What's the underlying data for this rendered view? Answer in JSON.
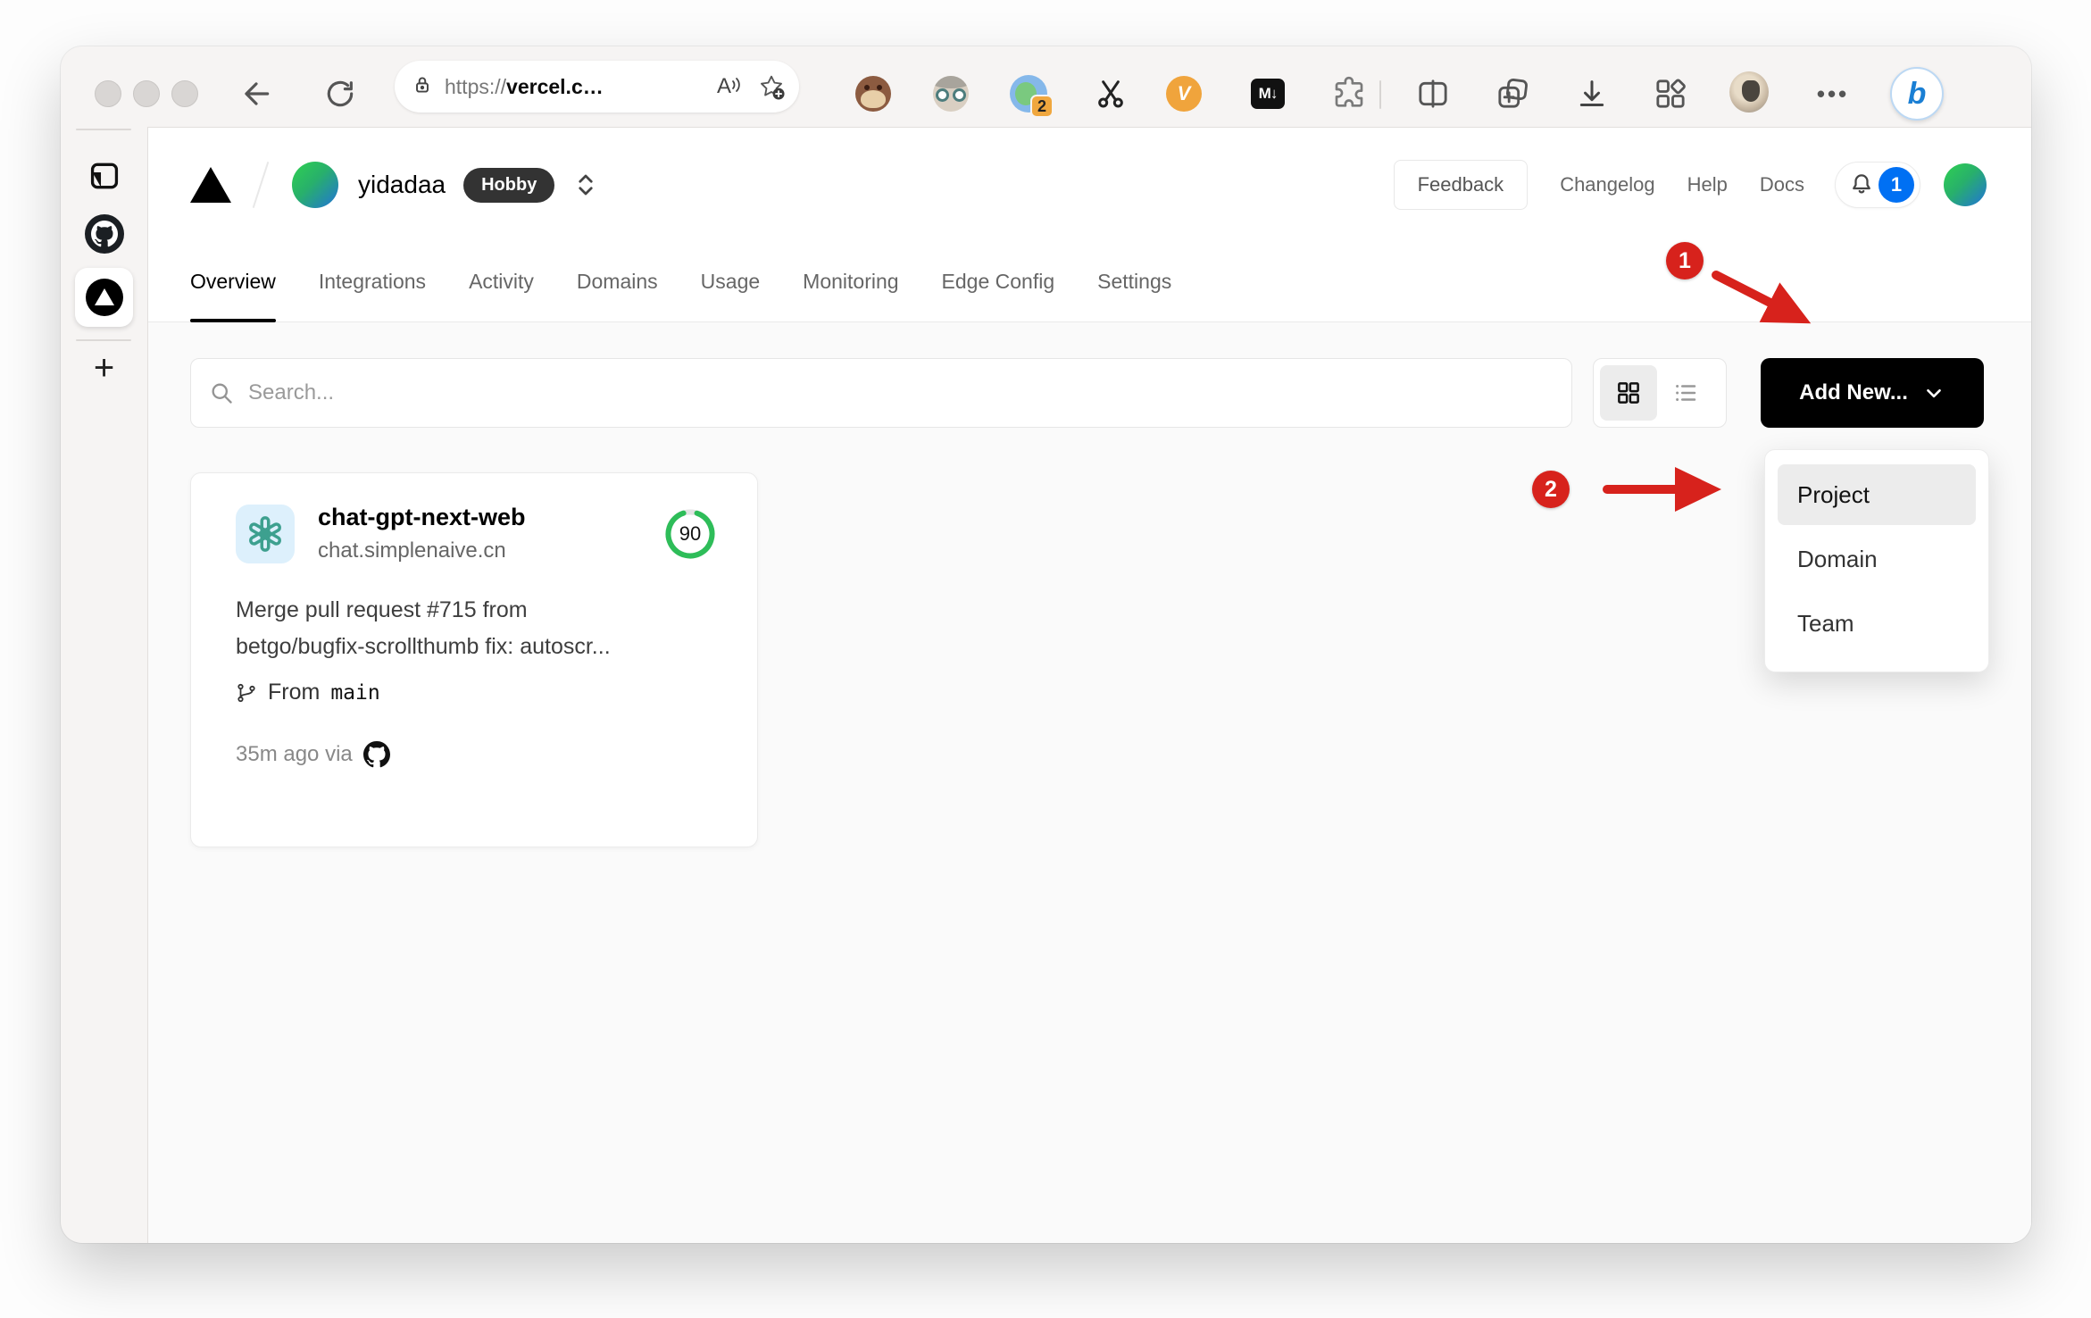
{
  "colors": {
    "accent_red": "#d7221c",
    "ring_green": "#2ebd59",
    "badge_blue": "#0070f3",
    "openai_teal": "#3da08f",
    "openai_tile_bg": "#ddf0fc",
    "av_from": "#2fd150",
    "av_mid": "#28b06b",
    "av_to": "#2173d8"
  },
  "browser": {
    "url": {
      "scheme": "https://",
      "domain": "vercel.c…"
    },
    "read_aloud_label": "A",
    "ext_tab_badge": "2",
    "ext_v_label": "V",
    "ext_md_label": "M↓",
    "more_dots": "•••",
    "copilot_label": "b",
    "toolbar_icon_names": [
      "back-icon",
      "reload-icon",
      "lock-icon",
      "read-aloud-icon",
      "favorite-add-icon",
      "tampermonkey-icon",
      "avatar-ext-icon",
      "tab-manager-ext-icon",
      "scissors-icon",
      "v-ext-icon",
      "markdown-download-icon",
      "extensions-puzzle-icon",
      "split-screen-icon",
      "collections-icon",
      "download-icon",
      "apps-grid-icon",
      "profile-avatar",
      "more-icon",
      "copilot-bing-icon"
    ],
    "sidebar_icon_names": [
      "tab-panel-icon",
      "github-favicon",
      "vercel-favicon-active-tab",
      "new-tab-plus"
    ]
  },
  "header": {
    "team_name": "yidadaa",
    "plan_badge": "Hobby",
    "feedback": "Feedback",
    "changelog": "Changelog",
    "help": "Help",
    "docs": "Docs",
    "notification_count": "1"
  },
  "tabs": [
    {
      "label": "Overview",
      "active": true
    },
    {
      "label": "Integrations",
      "active": false
    },
    {
      "label": "Activity",
      "active": false
    },
    {
      "label": "Domains",
      "active": false
    },
    {
      "label": "Usage",
      "active": false
    },
    {
      "label": "Monitoring",
      "active": false
    },
    {
      "label": "Edge Config",
      "active": false
    },
    {
      "label": "Settings",
      "active": false
    }
  ],
  "controls": {
    "search_placeholder": "Search...",
    "add_new_label": "Add New..."
  },
  "dropdown": {
    "items": [
      {
        "label": "Project",
        "highlighted": true
      },
      {
        "label": "Domain",
        "highlighted": false
      },
      {
        "label": "Team",
        "highlighted": false
      }
    ]
  },
  "project_card": {
    "name": "chat-gpt-next-web",
    "domain": "chat.simplenaive.cn",
    "score": "90",
    "commit_line1": "Merge pull request #715 from",
    "commit_line2": "betgo/bugfix-scrollthumb fix: autoscr...",
    "branch_prefix": "From",
    "branch_name": "main",
    "deployed_meta": "35m ago via"
  },
  "annotations": {
    "step1": "1",
    "step2": "2"
  }
}
